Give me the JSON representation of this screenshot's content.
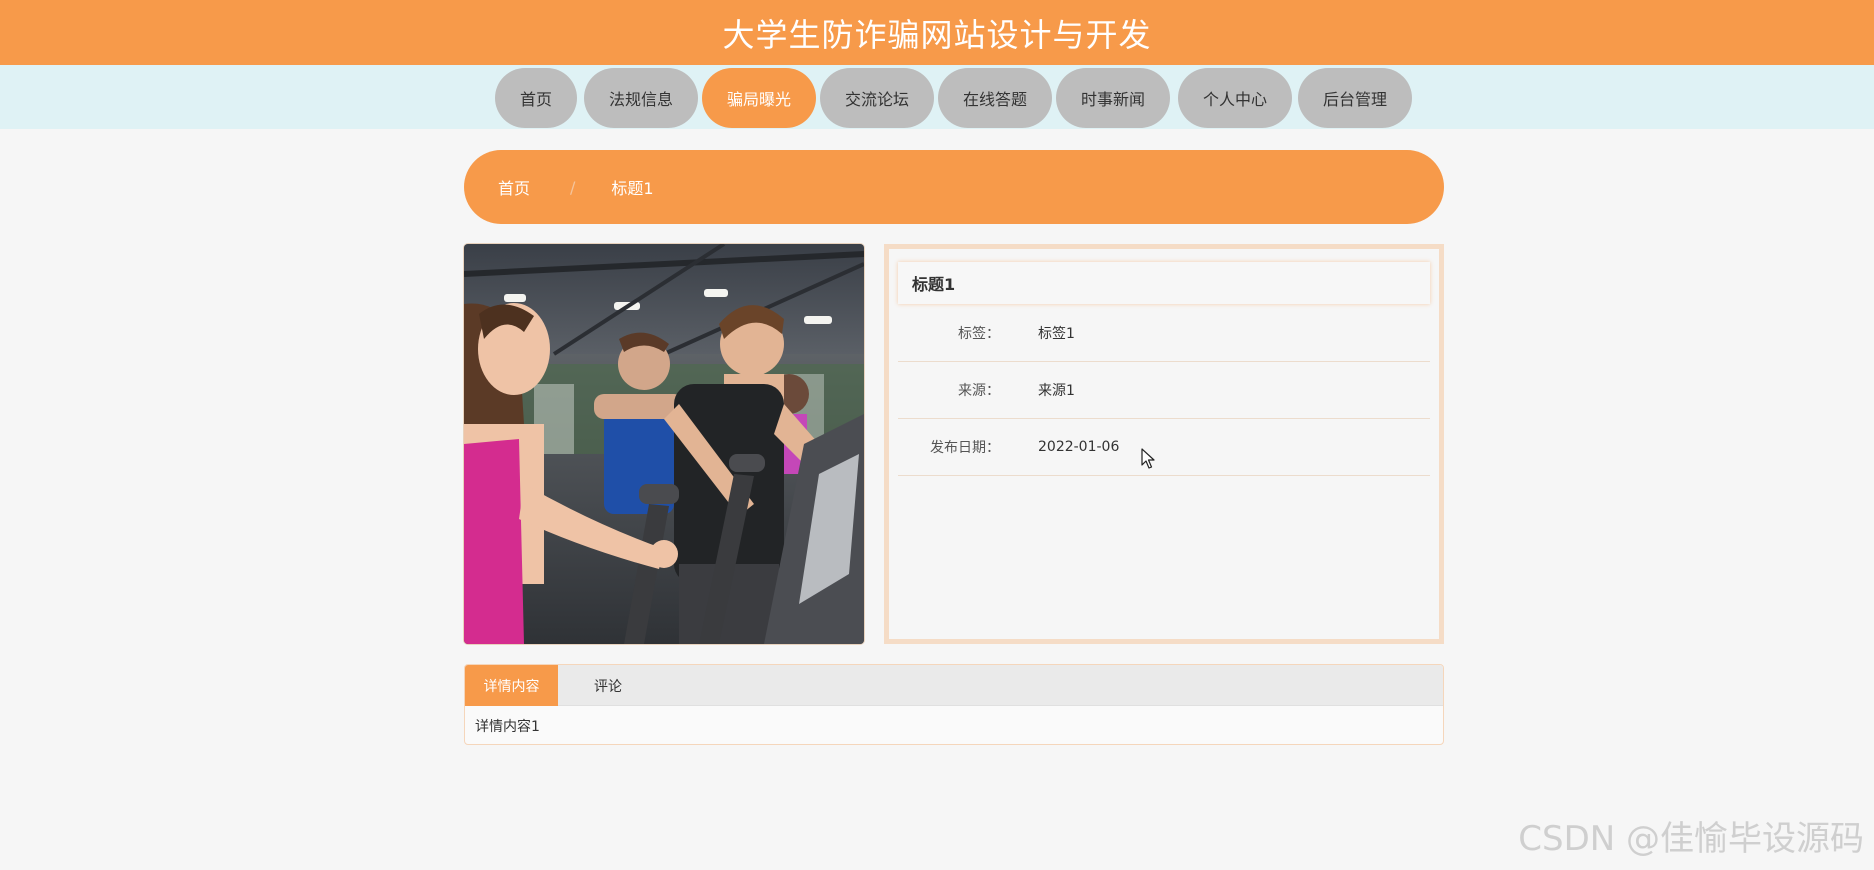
{
  "header": {
    "title": "大学生防诈骗网站设计与开发"
  },
  "nav": {
    "items": [
      {
        "label": "首页"
      },
      {
        "label": "法规信息"
      },
      {
        "label": "骗局曝光"
      },
      {
        "label": "交流论坛"
      },
      {
        "label": "在线答题"
      },
      {
        "label": "时事新闻"
      },
      {
        "label": "个人中心"
      },
      {
        "label": "后台管理"
      }
    ],
    "active": "骗局曝光"
  },
  "breadcrumb": {
    "home": "首页",
    "separator": "/",
    "current": "标题1"
  },
  "detail": {
    "title": "标题1",
    "fields": [
      {
        "label": "标签：",
        "value": "标签1"
      },
      {
        "label": "来源：",
        "value": "来源1"
      },
      {
        "label": "发布日期：",
        "value": "2022-01-06"
      }
    ]
  },
  "tabs": {
    "items": [
      {
        "label": "详情内容"
      },
      {
        "label": "评论"
      }
    ],
    "active": "详情内容",
    "content": "详情内容1"
  },
  "watermark": "CSDN @佳愉毕设源码",
  "colors": {
    "accent": "#f79a4a",
    "nav_bg": "#dff2f5",
    "nav_item": "#bdbdbd"
  }
}
